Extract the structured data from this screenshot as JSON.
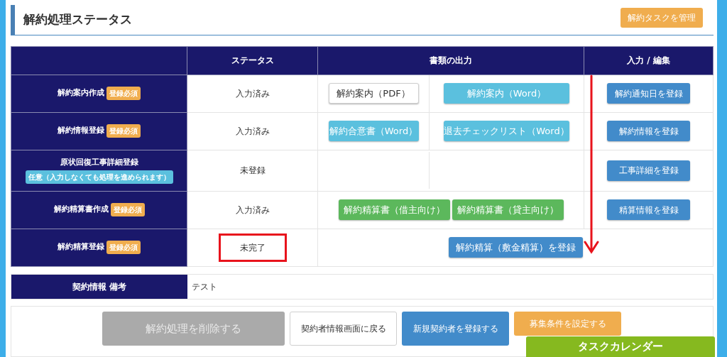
{
  "header": {
    "title": "解約処理ステータス",
    "manage_button": "解約タスクを管理"
  },
  "table": {
    "columns": [
      "ステータス",
      "書類の出力",
      "入力 / 編集"
    ],
    "rows": [
      {
        "label": "解約案内作成",
        "badge": {
          "kind": "required",
          "text": "登録必須"
        },
        "status": "入力済み",
        "highlighted": false,
        "kind": "split",
        "docs": [
          {
            "kind": "outline",
            "text": "解約案内（PDF）"
          },
          {
            "kind": "info",
            "text": "解約案内（Word）"
          }
        ],
        "edit": "解約通知日を登録"
      },
      {
        "label": "解約情報登録",
        "badge": {
          "kind": "required",
          "text": "登録必須"
        },
        "status": "入力済み",
        "highlighted": false,
        "kind": "split",
        "docs": [
          {
            "kind": "info",
            "text": "解約合意書（Word）"
          },
          {
            "kind": "info",
            "text": "退去チェックリスト（Word）"
          }
        ],
        "edit": "解約情報を登録"
      },
      {
        "label": "原状回復工事詳細登録",
        "badge": {
          "kind": "optional",
          "text": "任意（入力しなくても処理を進められます）"
        },
        "status": "未登録",
        "highlighted": false,
        "kind": "split",
        "docs": [],
        "edit": "工事詳細を登録"
      },
      {
        "label": "解約精算書作成",
        "badge": {
          "kind": "required",
          "text": "登録必須"
        },
        "status": "入力済み",
        "highlighted": false,
        "kind": "center",
        "docs": [
          {
            "kind": "success",
            "text": "解約精算書（借主向け）"
          },
          {
            "kind": "success",
            "text": "解約精算書（貸主向け）"
          }
        ],
        "edit": "精算情報を登録"
      },
      {
        "label": "解約精算登録",
        "badge": {
          "kind": "required",
          "text": "登録必須"
        },
        "status": "未完了",
        "highlighted": true,
        "kind": "merged",
        "docs": [
          {
            "kind": "primary",
            "text": "解約精算（敷金精算）を登録"
          }
        ]
      }
    ]
  },
  "remarks": {
    "label": "契約情報 備考",
    "value": "テスト"
  },
  "actions": [
    {
      "kind": "disabled",
      "text": "解約処理を削除する"
    },
    {
      "kind": "outline",
      "text": "契約者情報画面に戻る"
    },
    {
      "kind": "primary",
      "text": "新規契約者を登録する"
    },
    {
      "kind": "warning",
      "text": "募集条件を設定する"
    }
  ],
  "calendar_tab": "タスクカレンダー"
}
